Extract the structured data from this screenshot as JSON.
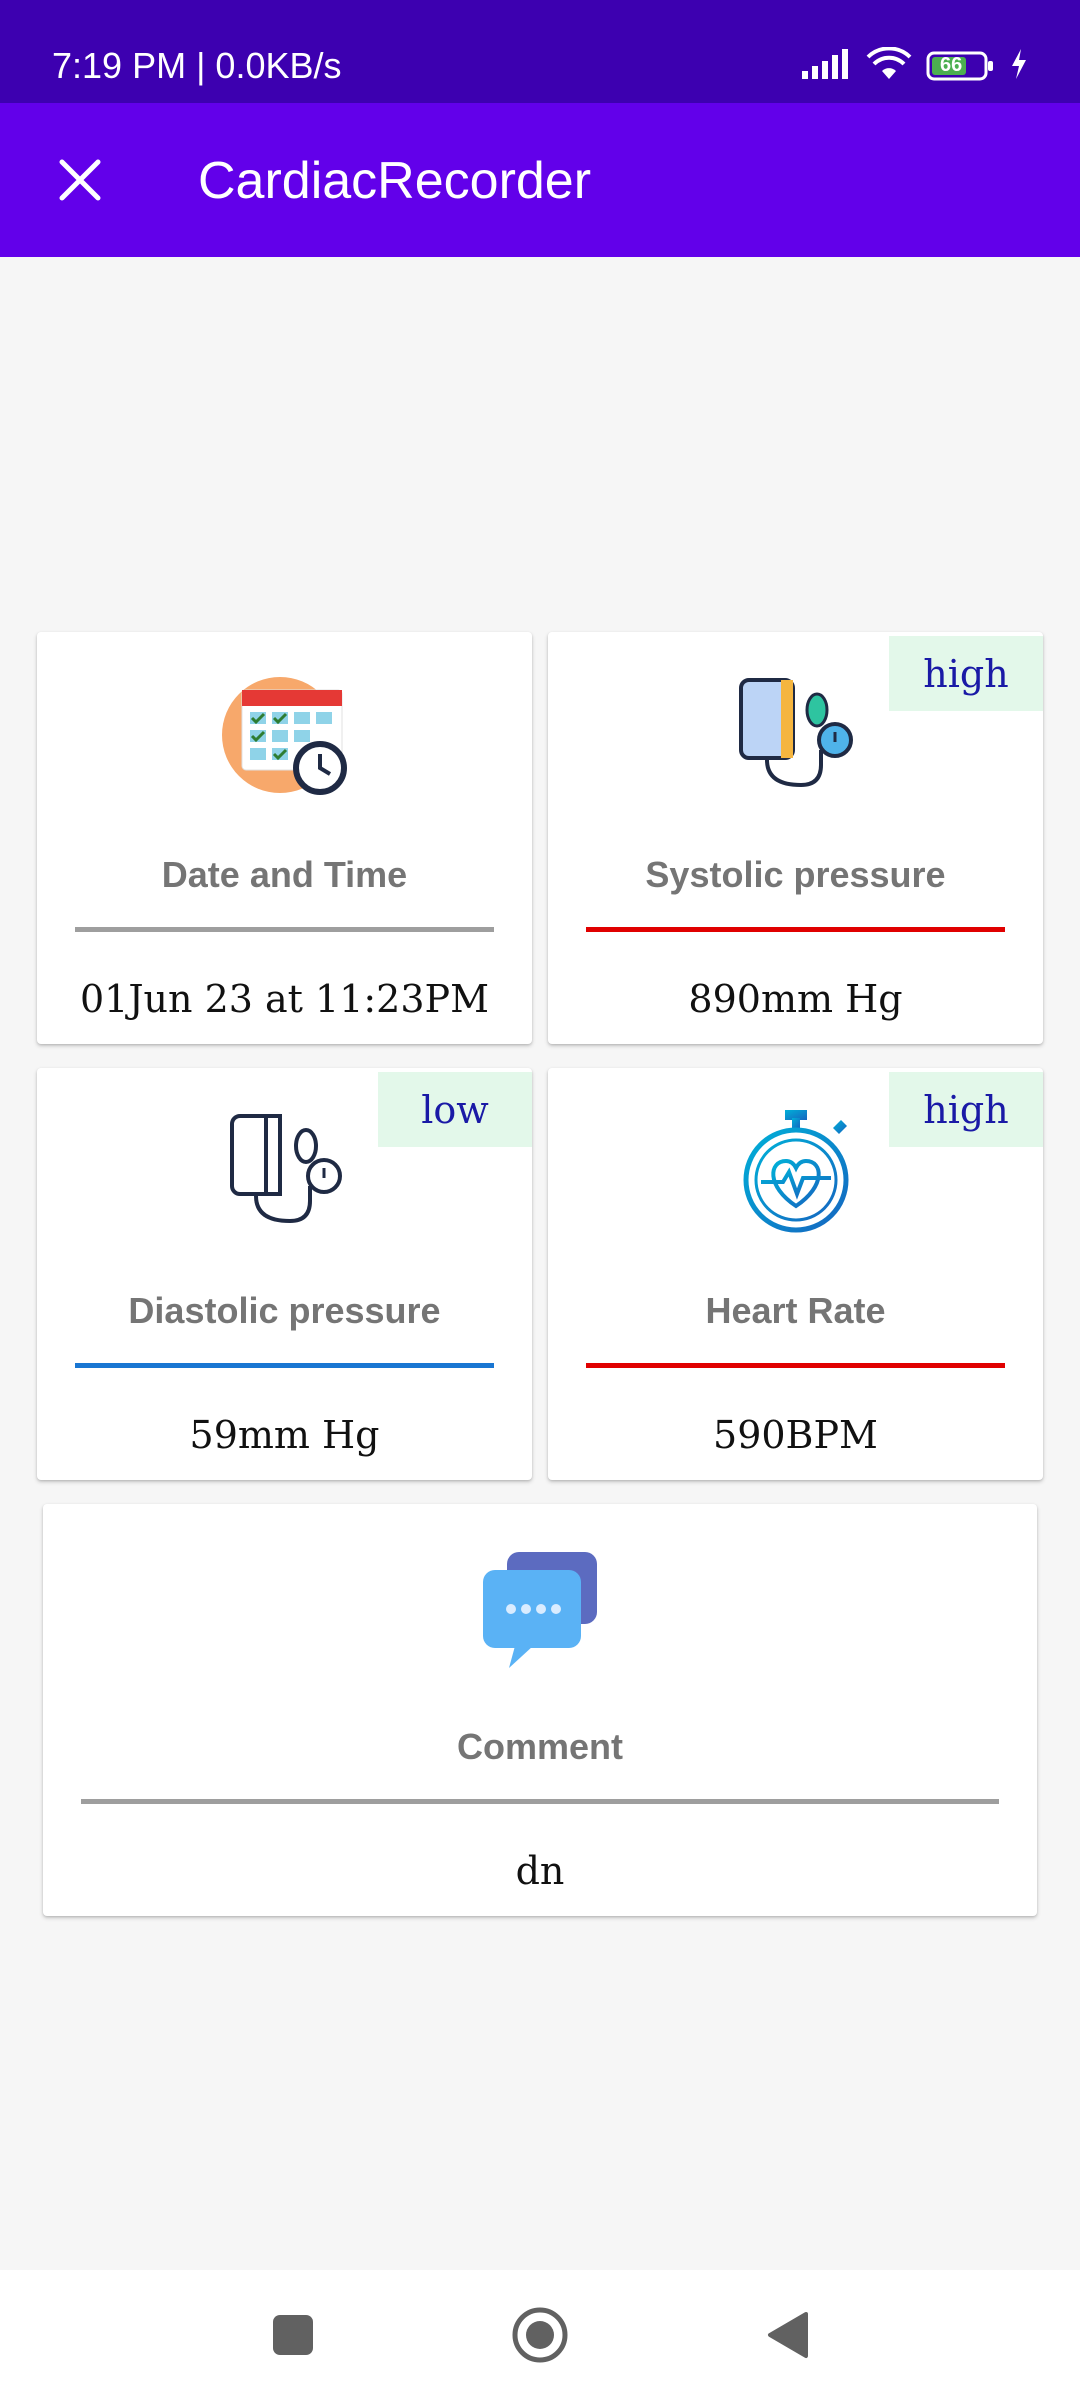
{
  "status_bar": {
    "time": "7:19 PM | 0.0KB/s",
    "battery_level": "66"
  },
  "app_bar": {
    "title": "CardiacRecorder",
    "close_icon": "close-icon"
  },
  "cards": {
    "date_time": {
      "label": "Date and Time",
      "value": "01Jun 23 at 11:23PM",
      "line_color": "#9e9e9e",
      "icon": "calendar-clock-icon"
    },
    "systolic": {
      "label": "Systolic pressure",
      "value": "890mm Hg",
      "badge": "high",
      "line_color": "#e00000",
      "icon": "blood-pressure-monitor-icon"
    },
    "diastolic": {
      "label": "Diastolic pressure",
      "value": "59mm Hg",
      "badge": "low",
      "line_color": "#1976d2",
      "icon": "blood-pressure-monitor-outline-icon"
    },
    "heart_rate": {
      "label": "Heart Rate",
      "value": "590BPM",
      "badge": "high",
      "line_color": "#e00000",
      "icon": "heart-stopwatch-icon"
    },
    "comment": {
      "label": "Comment",
      "value": "dn",
      "line_color": "#9e9e9e",
      "icon": "chat-bubbles-icon"
    }
  },
  "nav_bar": {
    "buttons": [
      "recents-button",
      "home-button",
      "back-button"
    ]
  },
  "colors": {
    "status_bar": "#3d00b0",
    "app_bar": "#6200ea",
    "background": "#f6f6f6",
    "badge_bg": "#e3f8ea",
    "badge_text": "#1a1aa6"
  }
}
